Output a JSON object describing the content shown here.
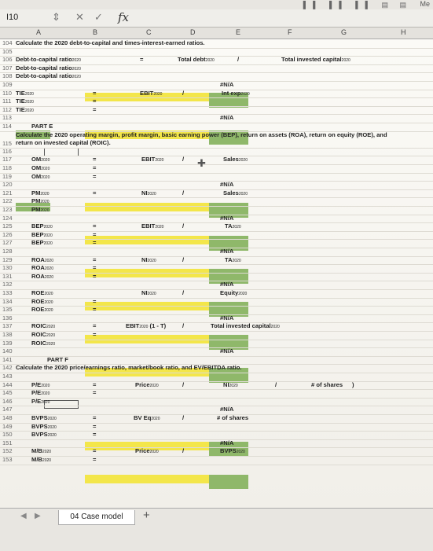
{
  "toolbar": {
    "icons": "▌▌ ▌▌ ▌▌ ▤ ▤",
    "user": "Me"
  },
  "formula_bar": {
    "name_box": "I10",
    "fx": "fx",
    "cancel": "✕",
    "confirm": "✓",
    "stepper": "⇕"
  },
  "columns": [
    "A",
    "B",
    "C",
    "D",
    "E",
    "F",
    "G",
    "H"
  ],
  "rows": {
    "r104": {
      "num": "104",
      "text": "Calculate the 2020 debt-to-capital and times-interest-earned ratios."
    },
    "r105": {
      "num": "105"
    },
    "r106": {
      "num": "106",
      "label": "Debt-to-capital ratio",
      "label_sub": "2020",
      "eq": "=",
      "c": "Total debt",
      "c_sub": "2020",
      "div": "/",
      "e": "Total invested capital",
      "e_sub": "2020"
    },
    "r107": {
      "num": "107",
      "label": "Debt-to-capital ratio",
      "label_sub": "2020"
    },
    "r108": {
      "num": "108",
      "label": "Debt-to-capital ratio",
      "label_sub": "2020"
    },
    "r109": {
      "num": "109",
      "na": "#N/A"
    },
    "r110": {
      "num": "110",
      "label": "TIE",
      "label_sub": "2020",
      "c": "EBIT",
      "c_sub": "2020",
      "eq": "=",
      "div": "/",
      "e": "Int exp",
      "e_sub": "2020"
    },
    "r111": {
      "num": "111",
      "label": "TIE",
      "label_sub": "2020",
      "eq": "="
    },
    "r112": {
      "num": "112",
      "label": "TIE",
      "label_sub": "2020",
      "eq": "="
    },
    "r113": {
      "num": "113",
      "na": "#N/A"
    },
    "r114": {
      "num": "114",
      "part": "PART E"
    },
    "r115": {
      "num": "115",
      "text1": "Calculate the 2020 operating margin, profit margin, basic earning power (BEP), return on assets (ROA), return on equity (ROE), and",
      "text2": "return on invested capital (ROIC)."
    },
    "r116": {
      "num": "116"
    },
    "r117": {
      "num": "117",
      "label": "OM",
      "label_sub": "2020",
      "eq": "=",
      "c": "EBIT",
      "c_sub": "2020",
      "div": "/",
      "e": "Sales",
      "e_sub": "2020"
    },
    "r118": {
      "num": "118",
      "label": "OM",
      "label_sub": "2020",
      "eq": "="
    },
    "r119": {
      "num": "119",
      "label": "OM",
      "label_sub": "2020",
      "eq": "="
    },
    "r120": {
      "num": "120",
      "na": "#N/A"
    },
    "r121": {
      "num": "121",
      "label": "PM",
      "label_sub": "2020",
      "eq": "=",
      "c": "NI",
      "c_sub": "2020",
      "div": "/",
      "e": "Sales",
      "e_sub": "2020"
    },
    "r122": {
      "num": "122",
      "label": "PM",
      "label_sub": "2020"
    },
    "r123": {
      "num": "123",
      "label": "PM",
      "label_sub": "2020"
    },
    "r124": {
      "num": "124",
      "na": "#N/A"
    },
    "r125": {
      "num": "125",
      "label": "BEP",
      "label_sub": "2020",
      "eq": "=",
      "c": "EBIT",
      "c_sub": "2020",
      "div": "/",
      "e": "TA",
      "e_sub": "2020"
    },
    "r126": {
      "num": "126",
      "label": "BEP",
      "label_sub": "2020",
      "eq": "="
    },
    "r127": {
      "num": "127",
      "label": "BEP",
      "label_sub": "2020",
      "eq": "="
    },
    "r128": {
      "num": "128",
      "na": "#N/A"
    },
    "r129": {
      "num": "129",
      "label": "ROA",
      "label_sub": "2020",
      "eq": "=",
      "c": "NI",
      "c_sub": "2020",
      "div": "/",
      "e": "TA",
      "e_sub": "2020"
    },
    "r130": {
      "num": "130",
      "label": "ROA",
      "label_sub": "2020",
      "eq": "="
    },
    "r131": {
      "num": "131",
      "label": "ROA",
      "label_sub": "2020",
      "eq": "="
    },
    "r132": {
      "num": "132",
      "na": "#N/A"
    },
    "r133": {
      "num": "133",
      "label": "ROE",
      "label_sub": "2020",
      "c": "NI",
      "c_sub": "2020",
      "div": "/",
      "e": "Equity",
      "e_sub": "2020"
    },
    "r134": {
      "num": "134",
      "label": "ROE",
      "label_sub": "2020",
      "eq": "="
    },
    "r135": {
      "num": "135",
      "label": "ROE",
      "label_sub": "2020",
      "eq": "="
    },
    "r136": {
      "num": "136",
      "na": "#N/A"
    },
    "r137": {
      "num": "137",
      "label": "ROIC",
      "label_sub": "2020",
      "eq": "=",
      "c": "EBIT",
      "c_sub": "2020",
      "c_tail": " (1 - T)",
      "div": "/",
      "e": "Total invested capital",
      "e_sub": "2020"
    },
    "r138": {
      "num": "138",
      "label": "ROIC",
      "label_sub": "2020",
      "eq": "="
    },
    "r139": {
      "num": "139",
      "label": "ROIC",
      "label_sub": "2020"
    },
    "r140": {
      "num": "140",
      "na": "#N/A"
    },
    "r141": {
      "num": "141",
      "part": "PART F"
    },
    "r142": {
      "num": "142",
      "text": "Calculate the 2020 price/earnings ratio, market/book ratio, and EV/EBITDA ratio."
    },
    "r143": {
      "num": "143"
    },
    "r144": {
      "num": "144",
      "label": "P/E",
      "label_sub": "2020",
      "eq": "=",
      "c": "Price",
      "c_sub": "2020",
      "div": "/",
      "e": "NI",
      "e_sub": "2020",
      "div2": "/",
      "g": "# of shares",
      "paren": ")"
    },
    "r145": {
      "num": "145",
      "label": "P/E",
      "label_sub": "2020",
      "eq": "="
    },
    "r146": {
      "num": "146",
      "label": "P/E",
      "label_sub": "2020"
    },
    "r147": {
      "num": "147",
      "na": "#N/A"
    },
    "r148": {
      "num": "148",
      "label": "BVPS",
      "label_sub": "2020",
      "eq": "=",
      "c": "BV Eq",
      "c_sub": "2020",
      "div": "/",
      "e": "# of shares"
    },
    "r149": {
      "num": "149",
      "label": "BVPS",
      "label_sub": "2020",
      "eq": "="
    },
    "r150": {
      "num": "150",
      "label": "BVPS",
      "label_sub": "2020",
      "eq": "="
    },
    "r151": {
      "num": "151",
      "na": "#N/A"
    },
    "r152": {
      "num": "152",
      "label": "M/B",
      "label_sub": "2020",
      "eq": "=",
      "c": "Price",
      "c_sub": "2020",
      "div": "/",
      "e": "BVPS",
      "e_sub": "2020"
    },
    "r153": {
      "num": "153",
      "label": "M/B",
      "label_sub": "2020",
      "eq": "="
    }
  },
  "sheet": {
    "tab_label": "04 Case model",
    "add_label": "+",
    "prev": "◀",
    "next": "▶"
  },
  "colors": {
    "yellow": "#f3e64a",
    "green": "#8fb86a"
  }
}
